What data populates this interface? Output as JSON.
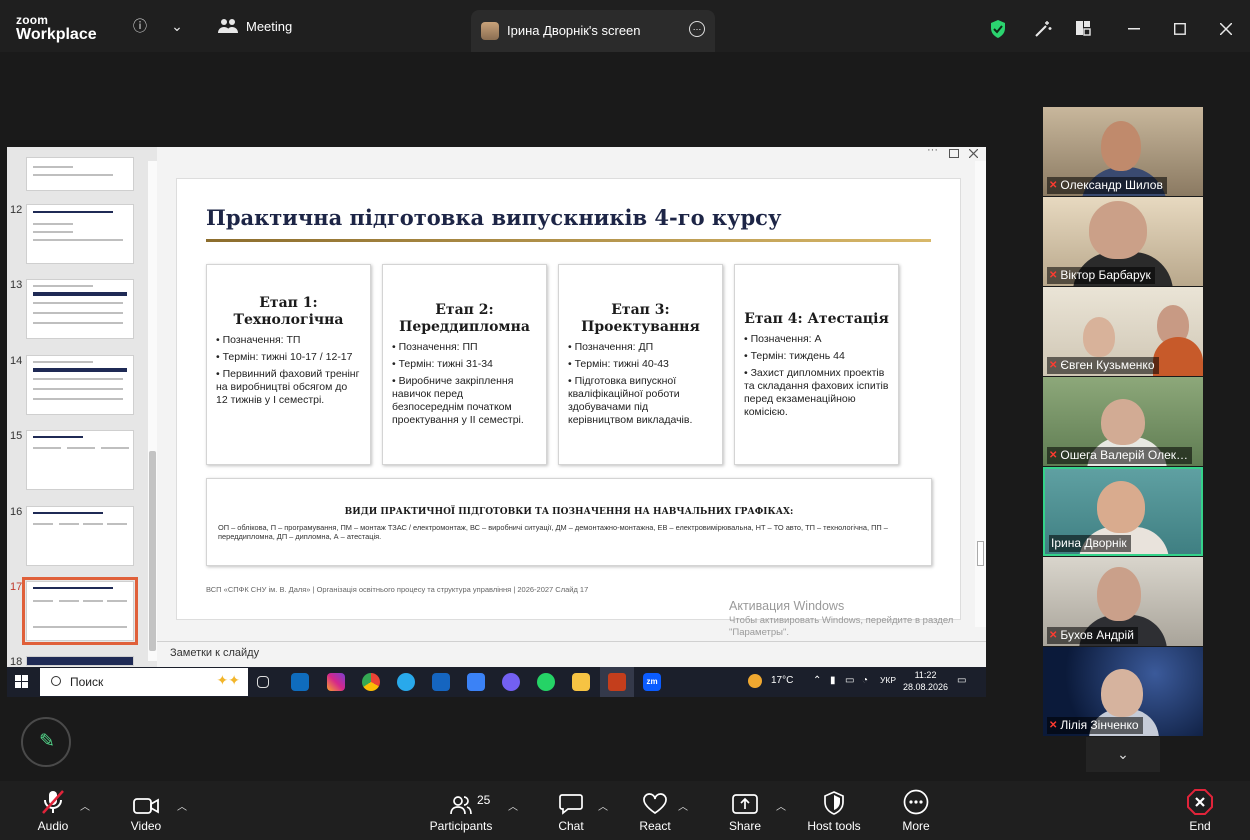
{
  "app": {
    "brand_line1": "zoom",
    "brand_line2": "Workplace"
  },
  "titlebar": {
    "meeting_label": "Meeting",
    "share_tab_title": "Ірина Дворнік's screen",
    "more_glyph": "…",
    "info_glyph": "ⓘ",
    "chevron_glyph": "⌄"
  },
  "thumbnails": [
    {
      "num": "12"
    },
    {
      "num": "13"
    },
    {
      "num": "14"
    },
    {
      "num": "15"
    },
    {
      "num": "16"
    },
    {
      "num": "17"
    },
    {
      "num": "18"
    }
  ],
  "slide": {
    "title": "Практична підготовка випускників 4-го курсу",
    "stages": [
      {
        "heading": "Етап 1: Технологічна",
        "items": [
          "• Позначення: ТП",
          "• Термін: тижні 10-17 / 12-17",
          "• Первинний фаховий тренінг на виробництві обсягом до 12 тижнів у I семестрі."
        ]
      },
      {
        "heading": "Етап 2: Переддипломна",
        "items": [
          "• Позначення: ПП",
          "• Термін: тижні 31-34",
          "• Виробниче закріплення навичок перед безпосереднім початком проектування у II семестрі."
        ]
      },
      {
        "heading": "Етап 3: Проектування",
        "items": [
          "• Позначення: ДП",
          "• Термін: тижні 40-43",
          "• Підготовка випускної кваліфікаційної роботи здобувачами під керівництвом викладачів."
        ]
      },
      {
        "heading": "Етап 4: Атестація",
        "items": [
          "• Позначення: А",
          "• Термін: тиждень 44",
          "• Захист дипломних проектів та складання фахових іспитів перед екзаменаційною комісією."
        ]
      }
    ],
    "kinds_heading": "ВИДИ ПРАКТИЧНОЇ ПІДГОТОВКИ ТА ПОЗНАЧЕННЯ НА НАВЧАЛЬНИХ ГРАФІКАХ:",
    "kinds_text": "ОП – облікова, П – програмування, ПМ – монтаж ТЗАС / електромонтаж, ВС – виробничі ситуації, ДМ – демонтажно-монтажна, ЕВ – електровимірювальна, НТ – ТО авто, ТП – технологічна, ПП – переддипломна, ДП – дипломна, А – атестація.",
    "footer": "ВСП «СПФК СНУ ім. В. Даля»  |  Організація освітнього процесу та структура управління  |  2026-2027     Слайд 17"
  },
  "notes_label": "Заметки к слайду",
  "watermark": {
    "title": "Активация Windows",
    "subtitle": "Чтобы активировать Windows, перейдите в раздел \"Параметры\"."
  },
  "taskbar": {
    "search_placeholder": "Поиск",
    "weather": "17°C",
    "lang": "УКР",
    "time": "11:22",
    "date": "28.08.2026",
    "zoom_app": "zm"
  },
  "participants": [
    {
      "name": "Олександр Шилов"
    },
    {
      "name": "Віктор Барбарук"
    },
    {
      "name": "Євген Кузьменко"
    },
    {
      "name": "Ошега Валерій Олек…"
    },
    {
      "name": "Ірина Дворнік"
    },
    {
      "name": "Бухов Андрій"
    },
    {
      "name": "Лілія Зінченко"
    }
  ],
  "controls": {
    "audio": "Audio",
    "video": "Video",
    "participants": "Participants",
    "participants_count": "25",
    "chat": "Chat",
    "react": "React",
    "share": "Share",
    "host_tools": "Host tools",
    "more": "More",
    "end": "End"
  },
  "colors": {
    "active_speaker": "#34d38a",
    "end_red": "#e0243a",
    "security_green": "#2bd46f",
    "current_slide_outline": "#e0603a"
  }
}
